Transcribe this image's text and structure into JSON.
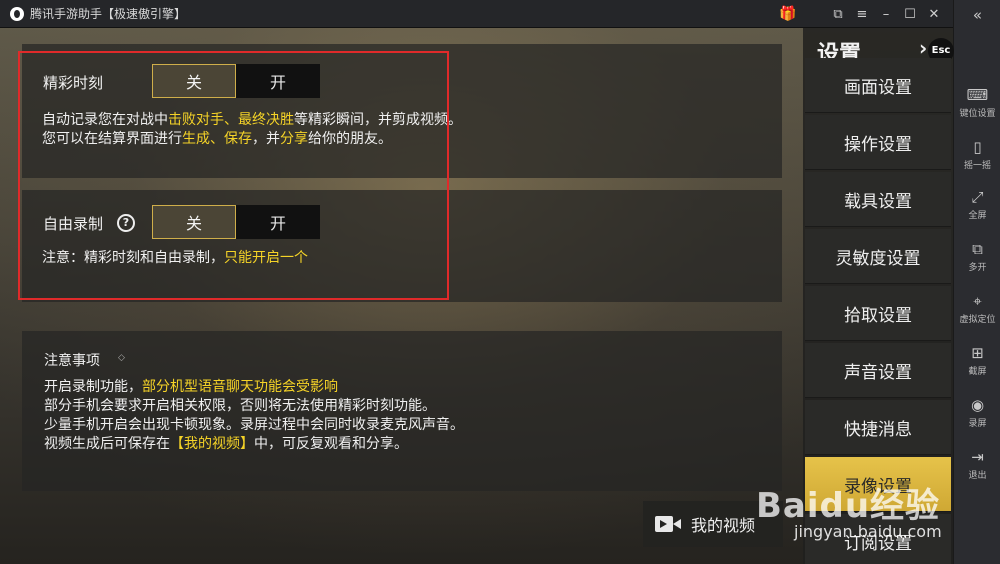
{
  "window": {
    "title": "腾讯手游助手【极速傲引擎】"
  },
  "toolbar": {
    "items": [
      {
        "label": "键位设置",
        "icon": "keyboard-icon"
      },
      {
        "label": "摇一摇",
        "icon": "shake-icon"
      },
      {
        "label": "全屏",
        "icon": "fullscreen-icon"
      },
      {
        "label": "多开",
        "icon": "multi-instance-icon"
      },
      {
        "label": "虚拟定位",
        "icon": "location-icon"
      },
      {
        "label": "截屏",
        "icon": "screenshot-icon"
      },
      {
        "label": "录屏",
        "icon": "record-icon"
      },
      {
        "label": "退出",
        "icon": "exit-icon"
      }
    ]
  },
  "highlights": {
    "label": "精彩时刻",
    "off": "关",
    "on": "开",
    "state": "off",
    "desc1_a": "自动记录您在对战中",
    "desc1_b": "击败对手、最终决胜",
    "desc1_c": "等精彩瞬间，并剪成视频。",
    "desc2_a": "您可以在结算界面进行",
    "desc2_b": "生成、保存",
    "desc2_c": "，并",
    "desc2_d": "分享",
    "desc2_e": "给你的朋友。"
  },
  "free_record": {
    "label": "自由录制",
    "off": "关",
    "on": "开",
    "state": "off",
    "note_a": "注意：精彩时刻和自由录制，",
    "note_b": "只能开启一个"
  },
  "notes": {
    "title": "注意事项",
    "line1_a": "开启录制功能，",
    "line1_b": "部分机型语音聊天功能会受影响",
    "line2": "部分手机会要求开启相关权限，否则将无法使用精彩时刻功能。",
    "line3": "少量手机开启会出现卡顿现象。录屏过程中会同时收录麦克风声音。",
    "line4_a": "视频生成后可保存在",
    "line4_b": "【我的视频】",
    "line4_c": "中，可反复观看和分享。"
  },
  "menu": {
    "title": "设置",
    "esc": "Esc",
    "items": [
      {
        "label": "画面设置"
      },
      {
        "label": "操作设置"
      },
      {
        "label": "载具设置"
      },
      {
        "label": "灵敏度设置"
      },
      {
        "label": "拾取设置"
      },
      {
        "label": "声音设置"
      },
      {
        "label": "快捷消息"
      },
      {
        "label": "录像设置"
      },
      {
        "label": "订阅设置"
      }
    ],
    "active_index": 7
  },
  "video_button": {
    "label": "我的视频"
  },
  "watermark": {
    "main": "Baidu经验",
    "sub": "jingyan.baidu.com"
  },
  "colors": {
    "highlight": "#f5d327",
    "frame": "#e02a2a",
    "menu_active": "#e6c34a"
  }
}
